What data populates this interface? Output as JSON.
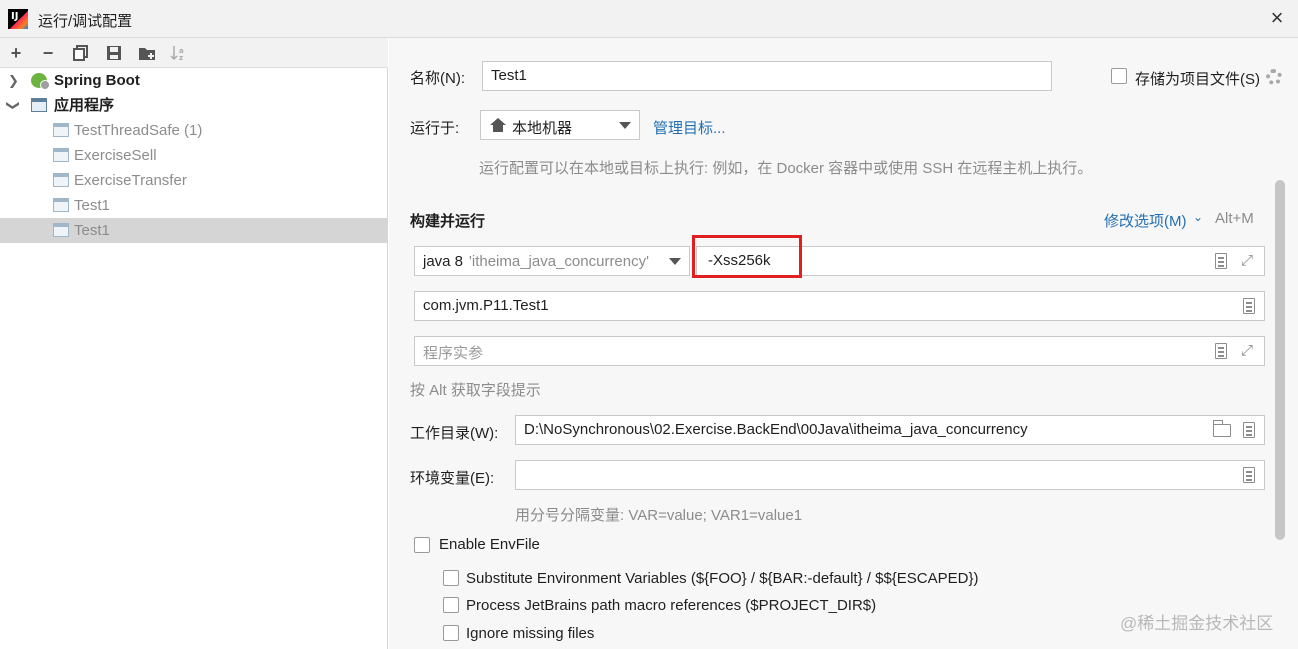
{
  "window": {
    "title": "运行/调试配置",
    "app_icon": "intellij-idea-icon",
    "close": "×"
  },
  "toolbar": {
    "add": "+",
    "remove": "−",
    "copy": "⧉",
    "save": "💾",
    "folder": "📁",
    "sort": "↓ᵃᶻ"
  },
  "tree": {
    "groups": [
      {
        "label": "Spring Boot",
        "expanded": false
      },
      {
        "label": "应用程序",
        "expanded": true
      }
    ],
    "items": [
      {
        "label": "TestThreadSafe (1)"
      },
      {
        "label": "ExerciseSell"
      },
      {
        "label": "ExerciseTransfer"
      },
      {
        "label": "Test1"
      },
      {
        "label": "Test1",
        "selected": true
      }
    ]
  },
  "form": {
    "name_label": "名称(N):",
    "name_value": "Test1",
    "store_as_project_file": "存储为项目文件(S)",
    "run_on_label": "运行于:",
    "run_on_value": "本地机器",
    "manage_targets": "管理目标...",
    "run_on_hint": "运行配置可以在本地或目标上执行: 例如，在 Docker 容器中或使用 SSH 在远程主机上执行。",
    "build_run_title": "构建并运行",
    "modify_options": "修改选项(M)",
    "modify_shortcut": "Alt+M",
    "jre_value": "java 8",
    "jre_module": "'itheima_java_concurrency'",
    "vm_options": "-Xss256k",
    "main_class": "com.jvm.P11.Test1",
    "program_args_placeholder": "程序实参",
    "alt_hint": "按 Alt 获取字段提示",
    "workdir_label": "工作目录(W):",
    "workdir_value": "D:\\NoSynchronous\\02.Exercise.BackEnd\\00Java\\itheima_java_concurrency",
    "env_label": "环境变量(E):",
    "env_value": "",
    "env_hint": "用分号分隔变量: VAR=value; VAR1=value1",
    "enable_envfile": "Enable EnvFile",
    "substitute_env": "Substitute Environment Variables (${FOO} / ${BAR:-default} / $${ESCAPED})",
    "process_macro": "Process JetBrains path macro references ($PROJECT_DIR$)",
    "ignore_missing": "Ignore missing files"
  },
  "watermark": "@稀土掘金技术社区",
  "colors": {
    "accent": "#2470b3",
    "highlight": "#e02020",
    "selection": "#d5d5d5"
  }
}
